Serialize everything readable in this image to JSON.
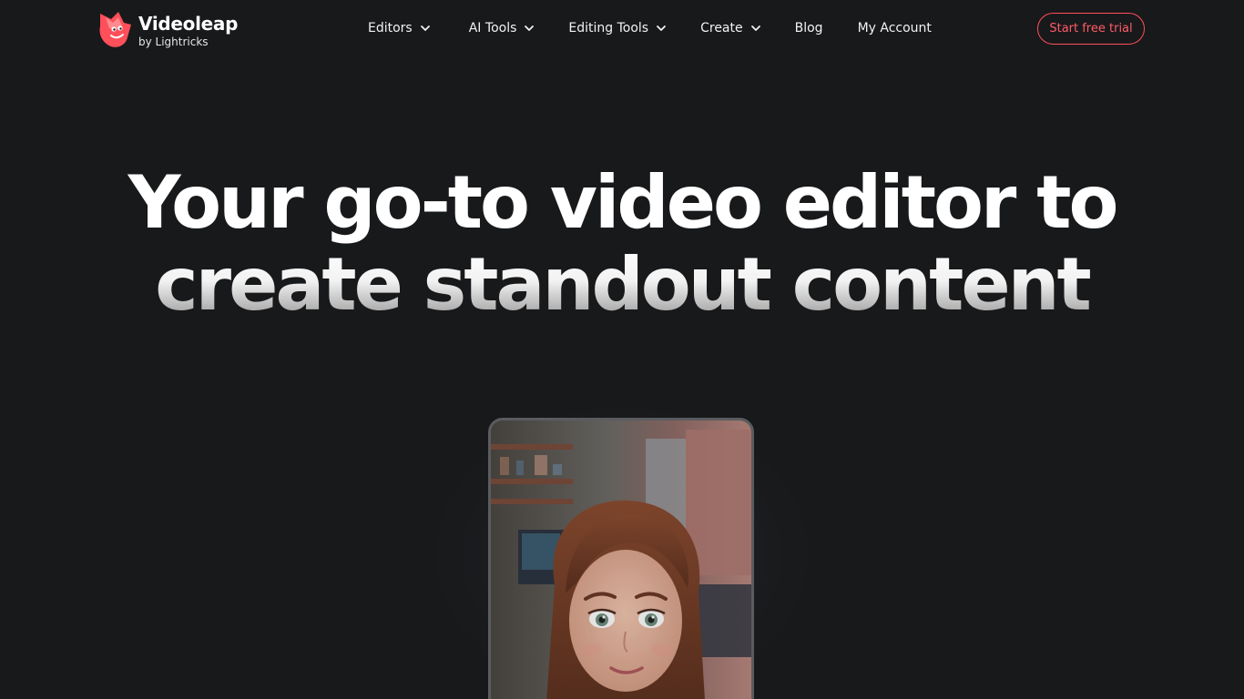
{
  "brand": {
    "name": "Videoleap",
    "byline": "by Lightricks",
    "accent": "#ff4f5a"
  },
  "nav": {
    "items": [
      {
        "label": "Editors",
        "has_dropdown": true
      },
      {
        "label": "AI Tools",
        "has_dropdown": true
      },
      {
        "label": "Editing Tools",
        "has_dropdown": true
      },
      {
        "label": "Create",
        "has_dropdown": true
      },
      {
        "label": "Blog",
        "has_dropdown": false
      },
      {
        "label": "My Account",
        "has_dropdown": false
      }
    ],
    "cta_label": "Start free trial"
  },
  "hero": {
    "line1": "Your go-to video editor to",
    "line2": "create standout content"
  },
  "phone": {
    "icon": "animated-avatar-preview"
  }
}
